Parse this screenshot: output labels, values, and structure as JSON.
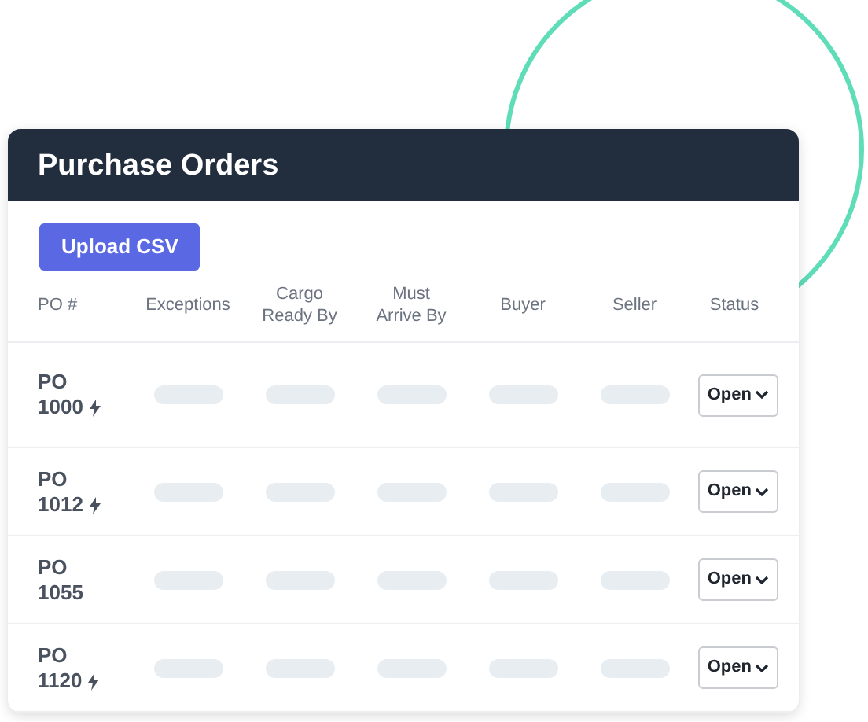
{
  "title": "Purchase Orders",
  "upload_button": "Upload CSV",
  "columns": [
    "PO #",
    "Exceptions",
    "Cargo Ready By",
    "Must Arrive By",
    "Buyer",
    "Seller",
    "Status"
  ],
  "rows": [
    {
      "po": "PO 1000",
      "flagged": true,
      "status": "Open"
    },
    {
      "po": "PO 1012",
      "flagged": true,
      "status": "Open"
    },
    {
      "po": "PO 1055",
      "flagged": false,
      "status": "Open"
    },
    {
      "po": "PO 1120",
      "flagged": true,
      "status": "Open"
    }
  ]
}
